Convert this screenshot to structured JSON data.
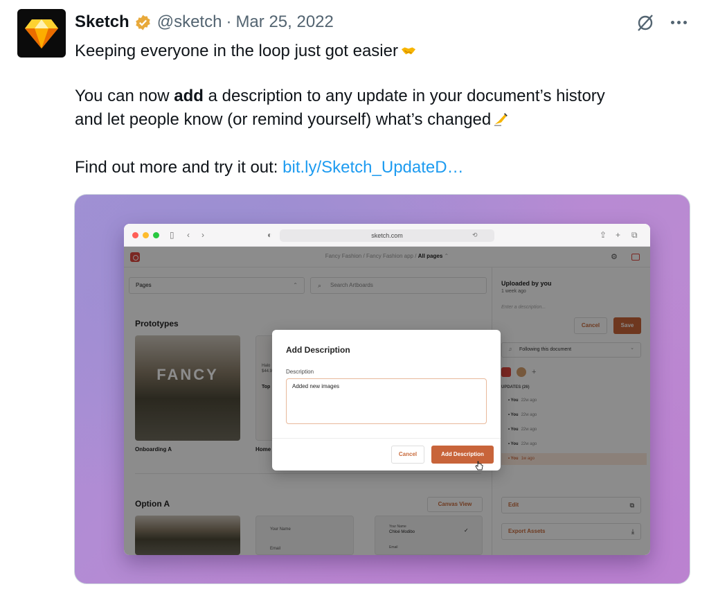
{
  "tweet": {
    "author_name": "Sketch",
    "handle": "@sketch",
    "separator": "·",
    "date": "Mar 25, 2022",
    "line1": "Keeping everyone in the loop just got easier",
    "line2_before": "You can now ",
    "line2_bold": "add",
    "line2_after": " a description to any update in your document’s history",
    "line3": "and let people know (or remind yourself) what’s changed",
    "line4_prefix": "Find out more and try it out: ",
    "link_text": "bit.ly/Sketch_UpdateD…",
    "colors": {
      "link": "#1d9bf0",
      "muted": "#536471",
      "verified": "#e8a93a"
    }
  },
  "browser": {
    "url": "sketch.com",
    "crumb_1": "Fancy Fashion",
    "crumb_sep": "/",
    "crumb_2": "Fancy Fashion app",
    "crumb_3": "All pages"
  },
  "app": {
    "pages_label": "Pages",
    "search_placeholder": "Search Artboards",
    "section1": "Prototypes",
    "thumb_text": "FANCY",
    "thumb1_label": "Onboarding A",
    "thumb2_label": "Home",
    "mini_home_1": "Halo",
    "mini_home_2": "$44.9",
    "mini_home_3": "Top",
    "section2": "Option A",
    "canvas_view": "Canvas View",
    "form_label_1": "Your Name",
    "form_label_2": "Email",
    "form_label_3": "Your Name",
    "form_value_3": "Chloé Modibo",
    "form_label_4": "Email"
  },
  "sidebar": {
    "title": "Uploaded by you",
    "subtitle": "1 week ago",
    "placeholder": "Enter a description...",
    "cancel": "Cancel",
    "save": "Save",
    "follow": "Following this document",
    "updates_header": "UPDATES (26)",
    "updates": [
      {
        "who": "You",
        "ago": "22w ago"
      },
      {
        "who": "You",
        "ago": "22w ago"
      },
      {
        "who": "You",
        "ago": "22w ago"
      },
      {
        "who": "You",
        "ago": "22w ago"
      },
      {
        "who": "You",
        "ago": "1w ago"
      }
    ],
    "edit": "Edit",
    "export": "Export Assets"
  },
  "modal": {
    "title": "Add Description",
    "label": "Description",
    "value": "Added new images",
    "cancel": "Cancel",
    "submit": "Add Description"
  }
}
